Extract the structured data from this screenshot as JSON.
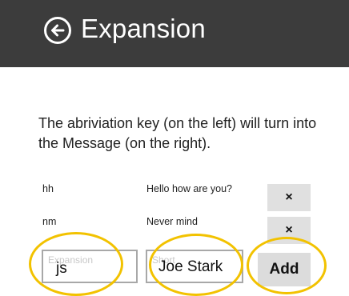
{
  "header": {
    "back_icon": "arrow-left-circle-icon",
    "title": "Expansion"
  },
  "description": "The abriviation key (on the left) will turn into the Message (on the right).",
  "entries": [
    {
      "key": "hh",
      "message": "Hello how are you?",
      "remove_label": "×"
    },
    {
      "key": "nm",
      "message": "Never mind",
      "remove_label": "×"
    }
  ],
  "form": {
    "key_placeholder": "Expansion",
    "key_value": "js",
    "message_placeholder": "Short",
    "message_value": "Joe Stark",
    "add_label": "Add"
  },
  "colors": {
    "header_bg": "#3c3c3c",
    "highlight": "#f2c200",
    "button_bg": "#e0e0e0"
  }
}
